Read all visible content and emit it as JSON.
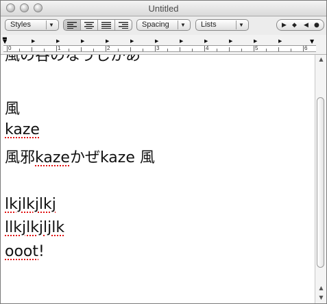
{
  "window": {
    "title": "Untitled"
  },
  "toolbar": {
    "styles_label": "Styles",
    "spacing_label": "Spacing",
    "lists_label": "Lists"
  },
  "ruler": {
    "numbers": [
      "0",
      "1",
      "2",
      "3",
      "4",
      "5",
      "6"
    ]
  },
  "document": {
    "line1": "風の谷のなうしかあ",
    "line2": "風",
    "line3": "kaze",
    "line4_a": "風邪",
    "line4_b": "kaze",
    "line4_c": "かぜkaze 風",
    "line5": "lkjlkjlkj",
    "line6": "llkjlkjljlk",
    "line7_a": "ooot",
    "line7_b": "!"
  }
}
